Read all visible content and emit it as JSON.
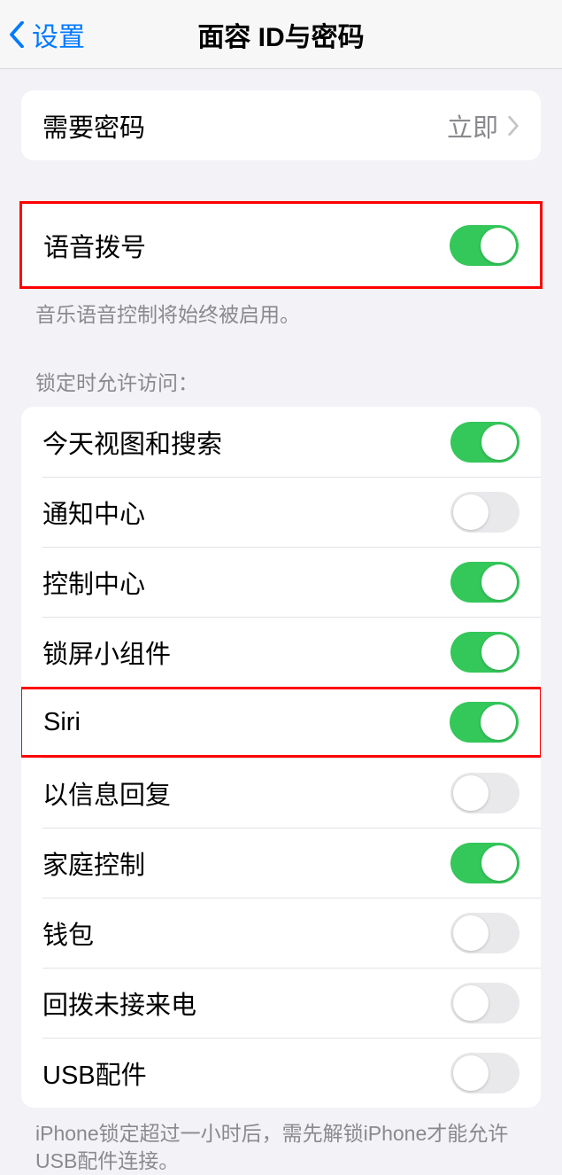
{
  "nav": {
    "back_label": "设置",
    "title": "面容 ID与密码"
  },
  "passcode_row": {
    "label": "需要密码",
    "value": "立即"
  },
  "voice_dial": {
    "label": "语音拨号",
    "on": true,
    "footer": "音乐语音控制将始终被启用。"
  },
  "locked_access": {
    "header": "锁定时允许访问：",
    "items": [
      {
        "label": "今天视图和搜索",
        "on": true,
        "hl": false
      },
      {
        "label": "通知中心",
        "on": false,
        "hl": false
      },
      {
        "label": "控制中心",
        "on": true,
        "hl": false
      },
      {
        "label": "锁屏小组件",
        "on": true,
        "hl": false
      },
      {
        "label": "Siri",
        "on": true,
        "hl": true
      },
      {
        "label": "以信息回复",
        "on": false,
        "hl": false
      },
      {
        "label": "家庭控制",
        "on": true,
        "hl": false
      },
      {
        "label": "钱包",
        "on": false,
        "hl": false
      },
      {
        "label": "回拨未接来电",
        "on": false,
        "hl": false
      },
      {
        "label": "USB配件",
        "on": false,
        "hl": false
      }
    ],
    "footer": "iPhone锁定超过一小时后，需先解锁iPhone才能允许USB配件连接。"
  }
}
